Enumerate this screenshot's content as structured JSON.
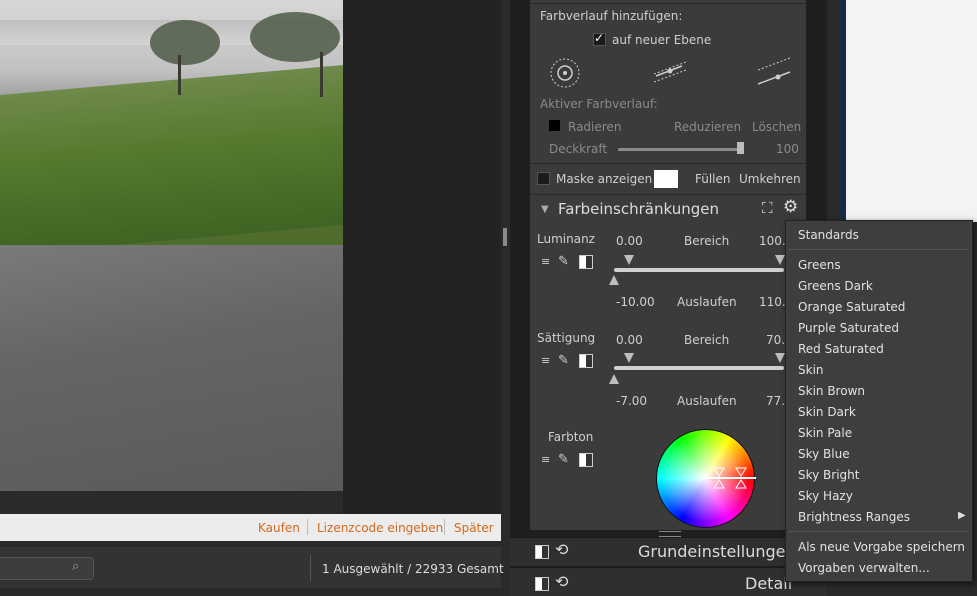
{
  "status": {
    "selection": "1 Ausgewählt / 22933 Gesamt"
  },
  "notice": {
    "buy": "Kaufen",
    "license": "Lizenzcode eingeben",
    "later": "Später"
  },
  "gradient": {
    "add_label": "Farbverlauf hinzufügen:",
    "new_layer_label": "auf neuer Ebene",
    "new_layer_checked": true,
    "active_label": "Aktiver Farbverlauf:",
    "erase": "Radieren",
    "reduce": "Reduzieren",
    "delete": "Löschen",
    "opacity_label": "Deckkraft",
    "opacity_value": "100",
    "show_mask": "Maske anzeigen",
    "fill": "Füllen",
    "invert": "Umkehren"
  },
  "color_restrictions": {
    "title": "Farbeinschränkungen",
    "luminance": {
      "label": "Luminanz",
      "min": "0.00",
      "range_label": "Bereich",
      "max": "100.",
      "fade_min": "-10.00",
      "fade_label": "Auslaufen",
      "fade_max": "110."
    },
    "saturation": {
      "label": "Sättigung",
      "min": "0.00",
      "range_label": "Bereich",
      "max": "70.",
      "fade_min": "-7.00",
      "fade_label": "Auslaufen",
      "fade_max": "77."
    },
    "hue": {
      "label": "Farbton"
    }
  },
  "modules": {
    "basic": "Grundeinstellungen",
    "detail": "Detail"
  },
  "presets_menu": {
    "items": [
      "Standards",
      "Greens",
      "Greens Dark",
      "Orange Saturated",
      "Purple Saturated",
      "Red Saturated",
      "Skin",
      "Skin Brown",
      "Skin Dark",
      "Skin Pale",
      "Sky Blue",
      "Sky Bright",
      "Sky Hazy",
      "Brightness Ranges"
    ],
    "save_new": "Als neue Vorgabe speichern",
    "manage": "Vorgaben verwalten..."
  },
  "colors": {
    "accent_link": "#d2691e",
    "panel_bg": "#3b3b3b"
  }
}
